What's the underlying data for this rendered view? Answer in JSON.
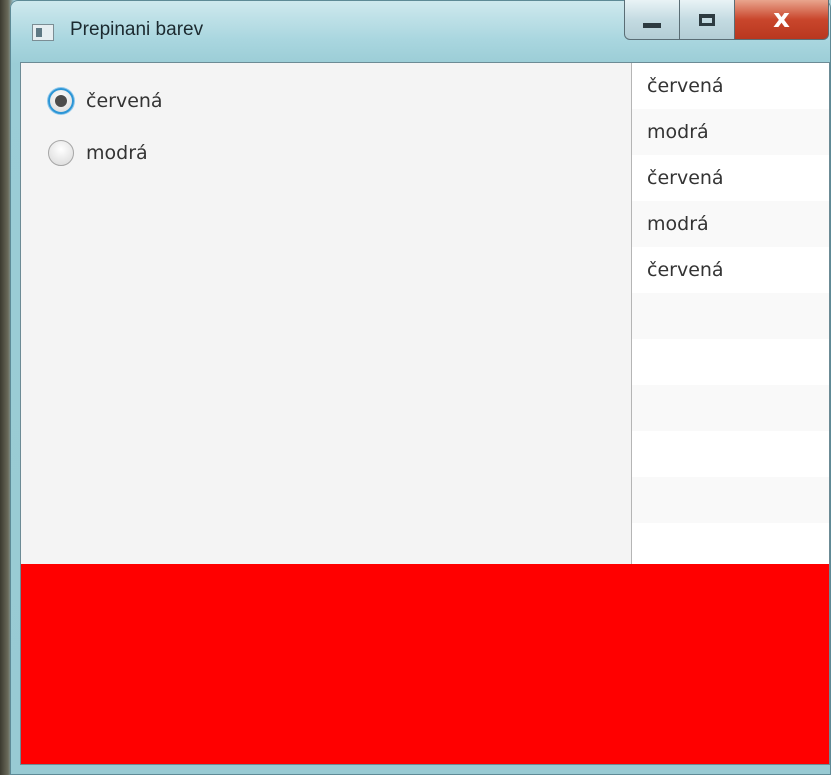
{
  "window": {
    "title": "Prepinani barev",
    "caption_close_glyph": "x"
  },
  "options": {
    "items": [
      {
        "label": "červená",
        "selected": true
      },
      {
        "label": "modrá",
        "selected": false
      }
    ]
  },
  "history": {
    "items": [
      "červená",
      "modrá",
      "červená",
      "modrá",
      "červená"
    ],
    "empty_rows": 5
  },
  "color_panel": {
    "current_color": "#ff0000"
  },
  "colors": {
    "accent": "#2b95d6",
    "panel_background": "#f4f4f4",
    "list_stripe": "#f9f9f9"
  }
}
